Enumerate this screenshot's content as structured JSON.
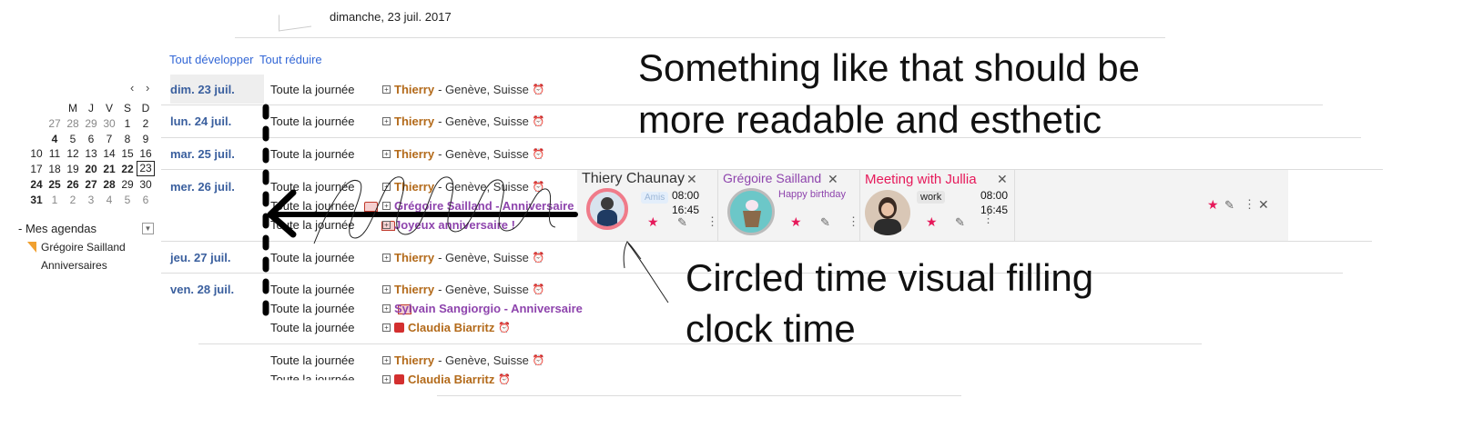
{
  "header": {
    "date": "dimanche, 23 juil. 2017"
  },
  "controls": {
    "expand_all": "Tout développer",
    "collapse_all": "Tout réduire"
  },
  "mini_calendar": {
    "nav_prev": "‹",
    "nav_next": "›",
    "weekdays": [
      "M",
      "J",
      "V",
      "S",
      "D"
    ],
    "rows": [
      [
        "27",
        "28",
        "29",
        "30",
        "1",
        "2"
      ],
      [
        "4",
        "5",
        "6",
        "7",
        "8",
        "9"
      ],
      [
        "10",
        "11",
        "12",
        "13",
        "14",
        "15",
        "16"
      ],
      [
        "17",
        "18",
        "19",
        "20",
        "21",
        "22",
        "23"
      ],
      [
        "24",
        "25",
        "26",
        "27",
        "28",
        "29",
        "30"
      ],
      [
        "31",
        "1",
        "2",
        "3",
        "4",
        "5",
        "6"
      ]
    ]
  },
  "sidebar": {
    "my_calendars": "Mes agendas",
    "calendars": [
      {
        "name": "Grégoire Sailland",
        "color": "#f0a030"
      },
      {
        "name": "Anniversaires"
      }
    ]
  },
  "agenda": {
    "all_day": "Toute la journée",
    "days": [
      "dim. 23 juil.",
      "lun. 24 juil.",
      "mar. 25 juil.",
      "mer. 26 juil.",
      "jeu. 27 juil.",
      "ven. 28 juil."
    ],
    "events": {
      "thierry_name": "Thierry",
      "thierry_loc": "- Genève, Suisse",
      "gregoire_anniv": "Grégoire Sailland - Anniversaire",
      "joyeux": "Joyeux anniversaire !",
      "sylvain_anniv": "Sylvain Sangiorgio - Anniversaire",
      "claudia": "Claudia Biarritz"
    }
  },
  "cards": [
    {
      "title": "Thiery Chaunay",
      "tag": "Amis",
      "start": "08:00",
      "end": "16:45",
      "title_color": "#333333"
    },
    {
      "title": "Grégoire Sailland",
      "subtitle": "Happy birthday",
      "title_color": "#8e44ad"
    },
    {
      "title": "Meeting with Jullia",
      "tag": "work",
      "start": "08:00",
      "end": "16:45",
      "title_color": "#e6195a"
    }
  ],
  "annotations": {
    "line1": "Something like that should be",
    "line2": "more readable and esthetic",
    "line3": "Circled time visual filling",
    "line4": "clock time"
  },
  "colors": {
    "accent_link": "#3367d6",
    "day_label": "#3a5f9e",
    "star": "#e6195a",
    "orange": "#b36a1a",
    "purple": "#8e44ad",
    "red": "#d32f2f"
  }
}
